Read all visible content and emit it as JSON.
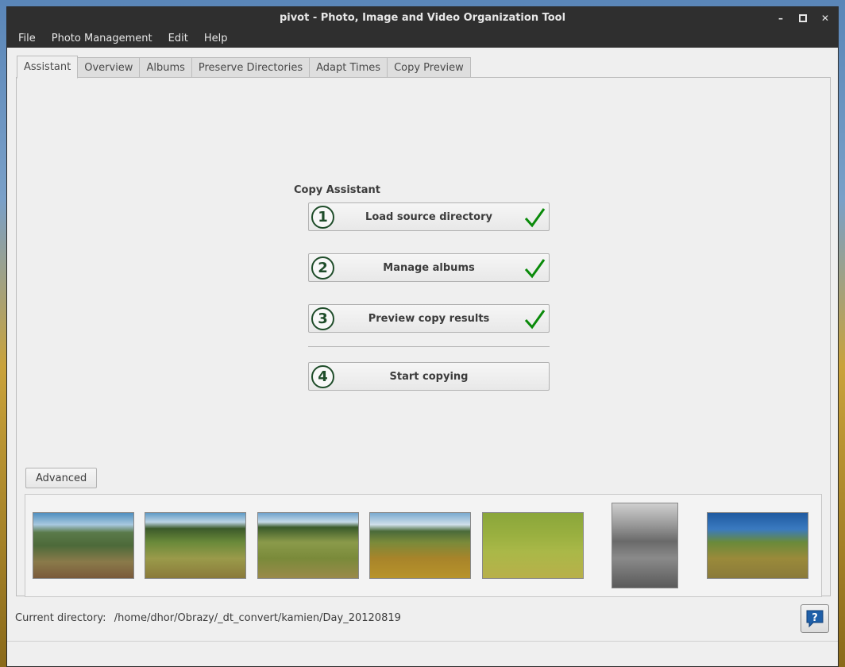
{
  "window": {
    "title": "pivot - Photo, Image and Video Organization Tool"
  },
  "menu": {
    "items": [
      "File",
      "Photo Management",
      "Edit",
      "Help"
    ]
  },
  "tabs": [
    "Assistant",
    "Overview",
    "Albums",
    "Preserve Directories",
    "Adapt Times",
    "Copy Preview"
  ],
  "assistant": {
    "title": "Copy Assistant",
    "steps": [
      {
        "num": "1",
        "label": "Load source directory",
        "done": true
      },
      {
        "num": "2",
        "label": "Manage albums",
        "done": true
      },
      {
        "num": "3",
        "label": "Preview copy results",
        "done": true
      },
      {
        "num": "4",
        "label": "Start copying",
        "done": false
      }
    ]
  },
  "advanced": {
    "label": "Advanced"
  },
  "status": {
    "label": "Current directory:",
    "path": "/home/dhor/Obrazy/_dt_convert/kamien/Day_20120819"
  },
  "colors": {
    "check": "#0a8a0a",
    "step_num": "#1f4d2a",
    "titlebar": "#2f2f2f",
    "help_icon": "#1f5fa8"
  },
  "icons": {
    "check": "check-icon",
    "help": "help-icon"
  }
}
